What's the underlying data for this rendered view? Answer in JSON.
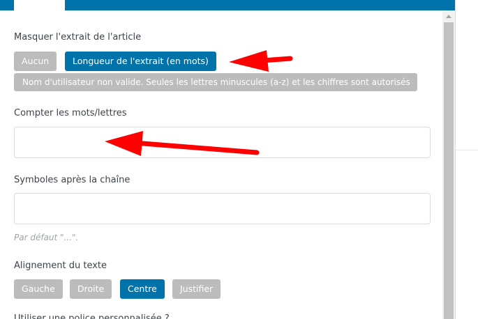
{
  "sections": {
    "excerpt": {
      "label": "Masquer l'extrait de l'article",
      "options": [
        {
          "label": "Aucun",
          "active": false
        },
        {
          "label": "Longueur de l'extrait (en mots)",
          "active": true
        }
      ],
      "message": "Nom d'utilisateur non valide. Seules les lettres minuscules (a-z) et les chiffres sont autorisés"
    },
    "count": {
      "label": "Compter les mots/lettres",
      "value": "",
      "placeholder": ""
    },
    "symbols": {
      "label": "Symboles après la chaîne",
      "value": "",
      "placeholder": "",
      "hint": "Par défaut \"...\"."
    },
    "align": {
      "label": "Alignement du texte",
      "options": [
        {
          "label": "Gauche",
          "active": false
        },
        {
          "label": "Droite",
          "active": false
        },
        {
          "label": "Centre",
          "active": true
        },
        {
          "label": "Justifier",
          "active": false
        }
      ]
    },
    "custom_font": {
      "label": "Utiliser une police personnalisée ?"
    }
  },
  "colors": {
    "accent": "#0073aa",
    "inactive_button": "#bcbcbc",
    "annotation_arrow": "#ff0000"
  }
}
